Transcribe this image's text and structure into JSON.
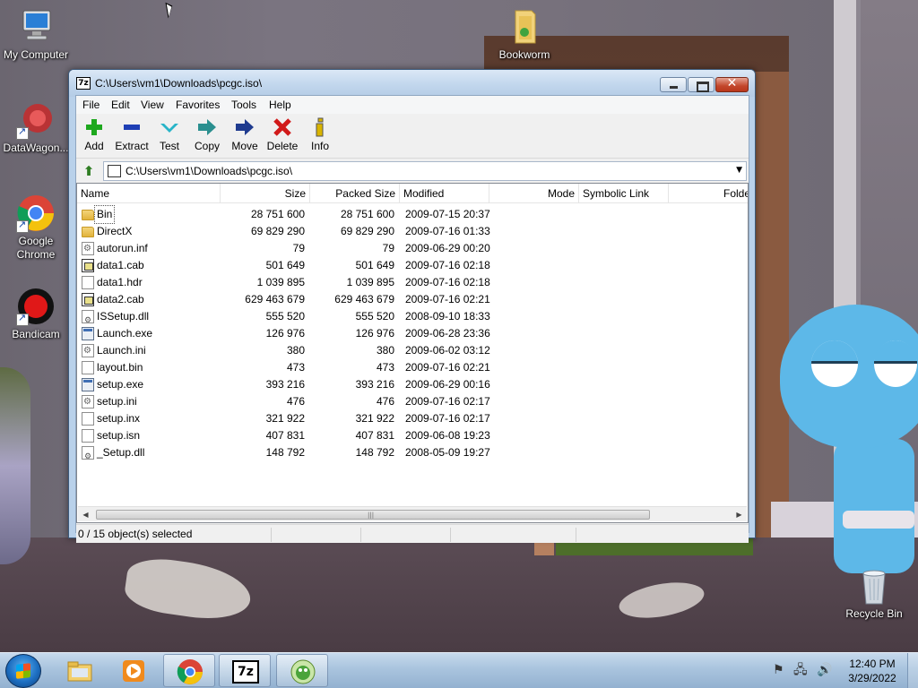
{
  "desktop": {
    "icons": [
      {
        "label": "My Computer",
        "icon": "computer-icon"
      },
      {
        "label": "DataWagon...",
        "icon": "datawagon-icon"
      },
      {
        "label": "Google Chrome",
        "icon": "chrome-icon"
      },
      {
        "label": "Bandicam",
        "icon": "bandicam-icon"
      },
      {
        "label": "Bookworm",
        "icon": "folder-icon"
      },
      {
        "label": "Recycle Bin",
        "icon": "recycle-bin-icon"
      }
    ]
  },
  "window": {
    "title": "C:\\Users\\vm1\\Downloads\\pcgc.iso\\",
    "app_icon_text": "7z",
    "menu": [
      "File",
      "Edit",
      "View",
      "Favorites",
      "Tools",
      "Help"
    ],
    "toolbar": [
      {
        "label": "Add",
        "icon": "plus-icon",
        "color": "#1ea81e"
      },
      {
        "label": "Extract",
        "icon": "minus-icon",
        "color": "#1e3fb5"
      },
      {
        "label": "Test",
        "icon": "checkmark-icon",
        "color": "#28b4c8"
      },
      {
        "label": "Copy",
        "icon": "copy-arrow-icon",
        "color": "#2a8f8f"
      },
      {
        "label": "Move",
        "icon": "move-arrow-icon",
        "color": "#1f3b8f"
      },
      {
        "label": "Delete",
        "icon": "delete-x-icon",
        "color": "#d11a1a"
      },
      {
        "label": "Info",
        "icon": "info-icon",
        "color": "#d9b400"
      }
    ],
    "address": "C:\\Users\\vm1\\Downloads\\pcgc.iso\\",
    "columns": [
      "Name",
      "Size",
      "Packed Size",
      "Modified",
      "Mode",
      "Symbolic Link",
      "Folder"
    ],
    "files": [
      {
        "name": "Bin",
        "size": "28 751 600",
        "packed": "28 751 600",
        "modified": "2009-07-15 20:37",
        "type": "folder"
      },
      {
        "name": "DirectX",
        "size": "69 829 290",
        "packed": "69 829 290",
        "modified": "2009-07-16 01:33",
        "type": "folder"
      },
      {
        "name": "autorun.inf",
        "size": "79",
        "packed": "79",
        "modified": "2009-06-29 00:20",
        "type": "cfg"
      },
      {
        "name": "data1.cab",
        "size": "501 649",
        "packed": "501 649",
        "modified": "2009-07-16 02:18",
        "type": "cab"
      },
      {
        "name": "data1.hdr",
        "size": "1 039 895",
        "packed": "1 039 895",
        "modified": "2009-07-16 02:18",
        "type": "file"
      },
      {
        "name": "data2.cab",
        "size": "629 463 679",
        "packed": "629 463 679",
        "modified": "2009-07-16 02:21",
        "type": "cab"
      },
      {
        "name": "ISSetup.dll",
        "size": "555 520",
        "packed": "555 520",
        "modified": "2008-09-10 18:33",
        "type": "dll"
      },
      {
        "name": "Launch.exe",
        "size": "126 976",
        "packed": "126 976",
        "modified": "2009-06-28 23:36",
        "type": "exe"
      },
      {
        "name": "Launch.ini",
        "size": "380",
        "packed": "380",
        "modified": "2009-06-02 03:12",
        "type": "cfg"
      },
      {
        "name": "layout.bin",
        "size": "473",
        "packed": "473",
        "modified": "2009-07-16 02:21",
        "type": "file"
      },
      {
        "name": "setup.exe",
        "size": "393 216",
        "packed": "393 216",
        "modified": "2009-06-29 00:16",
        "type": "exe"
      },
      {
        "name": "setup.ini",
        "size": "476",
        "packed": "476",
        "modified": "2009-07-16 02:17",
        "type": "cfg"
      },
      {
        "name": "setup.inx",
        "size": "321 922",
        "packed": "321 922",
        "modified": "2009-07-16 02:17",
        "type": "file"
      },
      {
        "name": "setup.isn",
        "size": "407 831",
        "packed": "407 831",
        "modified": "2009-06-08 19:23",
        "type": "file"
      },
      {
        "name": "_Setup.dll",
        "size": "148 792",
        "packed": "148 792",
        "modified": "2008-05-09 19:27",
        "type": "dll"
      }
    ],
    "status": "0 / 15 object(s) selected"
  },
  "taskbar": {
    "apps": [
      {
        "name": "windows-explorer",
        "icon": "explorer-folder-icon"
      },
      {
        "name": "media-player",
        "icon": "media-player-icon"
      },
      {
        "name": "google-chrome",
        "icon": "chrome-icon"
      },
      {
        "name": "7-zip",
        "icon": "7zip-icon",
        "text": "7z"
      },
      {
        "name": "bookworm",
        "icon": "bookworm-icon"
      }
    ],
    "time": "12:40 PM",
    "date": "3/29/2022"
  }
}
